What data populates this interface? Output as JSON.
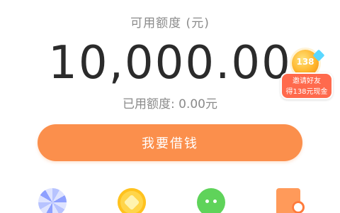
{
  "credit": {
    "available_label": "可用额度 (元)",
    "amount": "10,000.00",
    "used_label": "已用额度: 0.00元"
  },
  "invite_badge": {
    "number": "138",
    "line1": "邀请好友",
    "line2": "得138元现金"
  },
  "borrow_button": {
    "label": "我要借钱"
  },
  "bottom_icons": [
    "fan-icon",
    "coin-icon",
    "wechat-icon",
    "book-check-icon"
  ],
  "colors": {
    "button_orange": "#fb8f4c",
    "badge_red": "#ff6a4d",
    "badge_gold": "#ffb52b"
  }
}
